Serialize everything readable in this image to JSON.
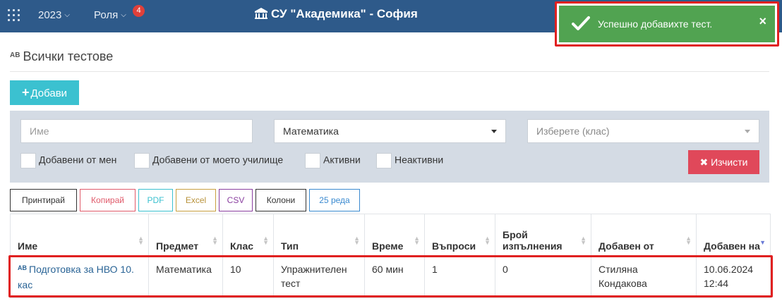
{
  "topbar": {
    "year": "2023",
    "role": "Роля",
    "notification_count": "4",
    "school_name": "СУ \"Академика\" - София"
  },
  "toast": {
    "message": "Успешно добавихте тест.",
    "close": "×"
  },
  "page": {
    "title": "Всички тестове",
    "title_icon": "AB"
  },
  "toolbar": {
    "add_label": "Добави",
    "add_icon": "+"
  },
  "filters": {
    "name_placeholder": "Име",
    "subject_value": "Математика",
    "class_placeholder": "Изберете (клас)",
    "checkboxes": [
      "Добавени от мен",
      "Добавени от моето училище",
      "Активни",
      "Неактивни"
    ],
    "clear_label": "✖ Изчисти"
  },
  "exports": [
    "Принтирай",
    "Копирай",
    "PDF",
    "Excel",
    "CSV",
    "Колони",
    "25 реда"
  ],
  "table": {
    "headers": [
      "Име",
      "Предмет",
      "Клас",
      "Тип",
      "Време",
      "Въпроси",
      "Брой изпълнения",
      "Добавен от",
      "Добавен на"
    ],
    "rows": [
      {
        "name": "Подготовка за НВО 10. кас",
        "subject": "Математика",
        "class": "10",
        "type": "Упражнителен тест",
        "time": "60 мин",
        "questions": "1",
        "runs": "0",
        "added_by": "Стиляна Кондакова",
        "added_on": "10.06.2024 12:44"
      }
    ]
  }
}
